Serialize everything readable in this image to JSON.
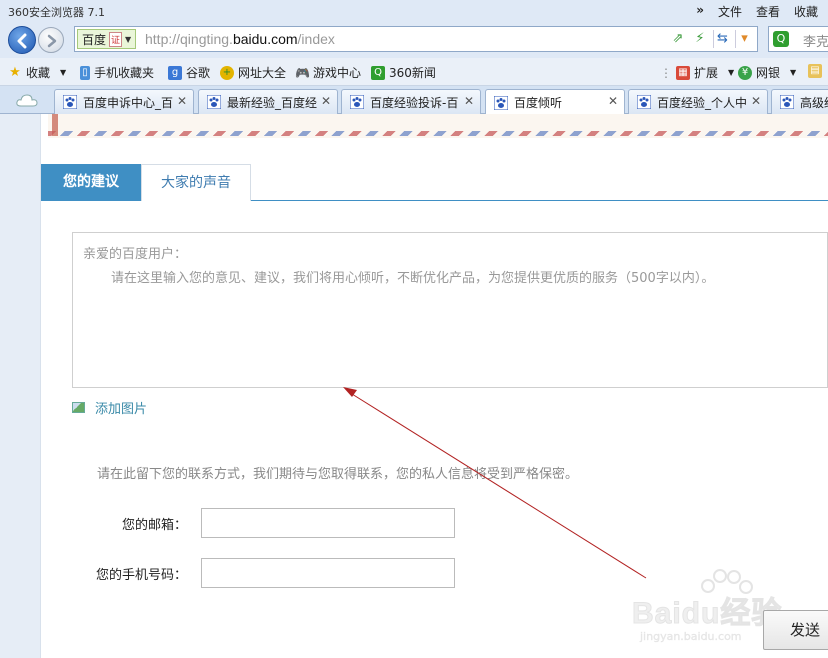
{
  "browser": {
    "app_title": "360安全浏览器 7.1",
    "menu": [
      "文件",
      "查看",
      "收藏"
    ],
    "menu_chevron": "»"
  },
  "address": {
    "site_name": "百度",
    "cert_label": "证",
    "url_prefix": "http://qingting.",
    "url_host": "baidu.com",
    "url_path": "/index",
    "search_placeholder": "李克"
  },
  "favorites": [
    {
      "label": "收藏",
      "icon": "star-plus-icon"
    },
    {
      "label": "手机收藏夹",
      "icon": "phone-icon"
    },
    {
      "label": "谷歌",
      "icon": "google-icon"
    },
    {
      "label": "网址大全",
      "icon": "globe-icon"
    },
    {
      "label": "游戏中心",
      "icon": "gamepad-icon"
    },
    {
      "label": "360新闻",
      "icon": "news-icon"
    },
    {
      "label": "扩展",
      "icon": "grid-icon"
    },
    {
      "label": "网银",
      "icon": "yen-icon"
    }
  ],
  "tabs": [
    {
      "label": "百度申诉中心_百",
      "active": false
    },
    {
      "label": "最新经验_百度经",
      "active": false
    },
    {
      "label": "百度经验投诉-百",
      "active": false
    },
    {
      "label": "百度倾听",
      "active": true
    },
    {
      "label": "百度经验_个人中",
      "active": false
    },
    {
      "label": "高级经",
      "active": false
    }
  ],
  "page": {
    "tab_suggestion": "您的建议",
    "tab_voices": "大家的声音",
    "feedback_greeting": "亲爱的百度用户：",
    "feedback_placeholder": "请在这里输入您的意见、建议，我们将用心倾听，不断优化产品，为您提供更优质的服务（500字以内）。",
    "add_image": "添加图片",
    "contact_note": "请在此留下您的联系方式，我们期待与您取得联系，您的私人信息将受到严格保密。",
    "email_label": "您的邮箱：",
    "email_value": "",
    "phone_label": "您的手机号码：",
    "phone_value": "",
    "send_label": "发送"
  },
  "watermark": {
    "text": "Baidu经验",
    "sub": "jingyan.baidu.com"
  },
  "colors": {
    "accent": "#3f8fc4",
    "annotation_arrow": "#b22222"
  }
}
